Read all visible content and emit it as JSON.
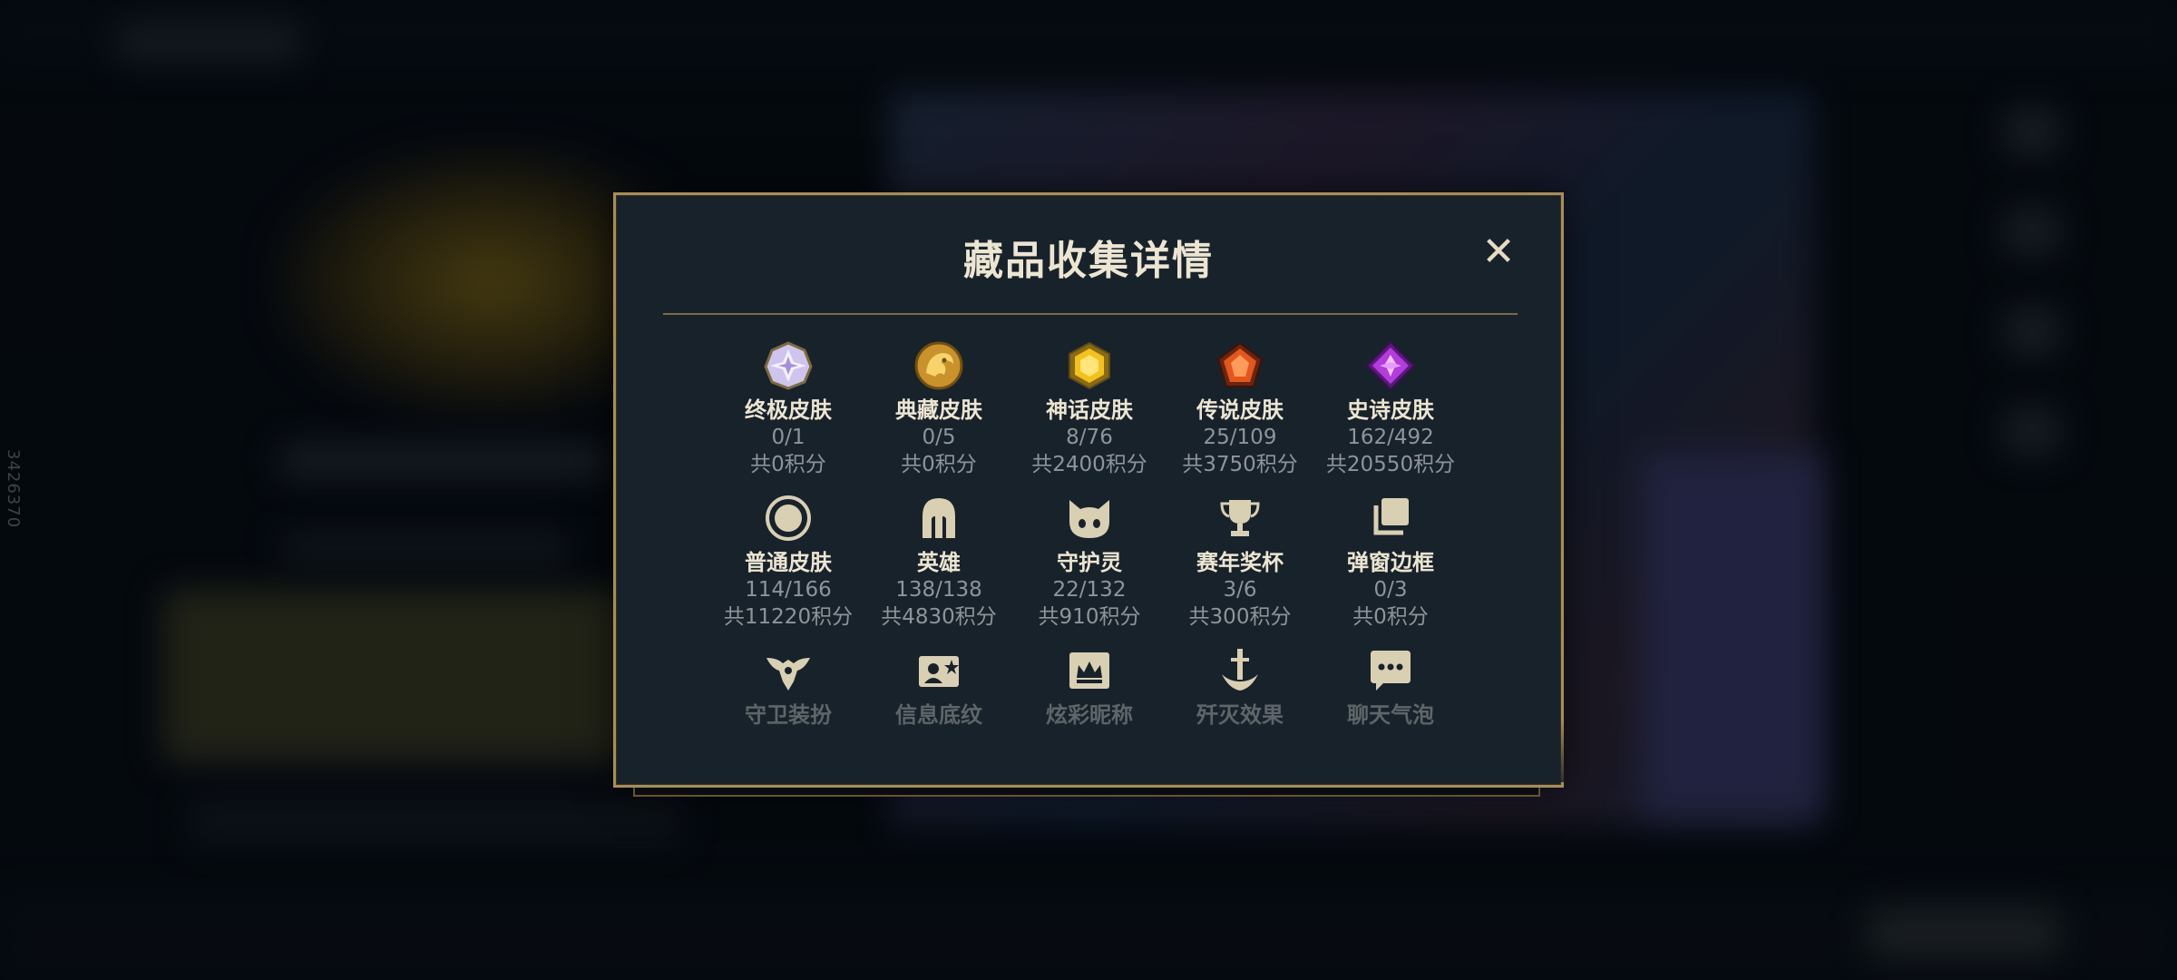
{
  "side_id": "3426370",
  "dialog": {
    "title": "藏品收集详情",
    "close_symbol": "✕"
  },
  "rows": [
    [
      {
        "label": "终极皮肤",
        "count": "0/1",
        "points": "共0积分",
        "icon": "ultimate-skin-icon"
      },
      {
        "label": "典藏皮肤",
        "count": "0/5",
        "points": "共0积分",
        "icon": "prestige-skin-icon"
      },
      {
        "label": "神话皮肤",
        "count": "8/76",
        "points": "共2400积分",
        "icon": "mythic-skin-icon"
      },
      {
        "label": "传说皮肤",
        "count": "25/109",
        "points": "共3750积分",
        "icon": "legendary-skin-icon"
      },
      {
        "label": "史诗皮肤",
        "count": "162/492",
        "points": "共20550积分",
        "icon": "epic-skin-icon"
      }
    ],
    [
      {
        "label": "普通皮肤",
        "count": "114/166",
        "points": "共11220积分",
        "icon": "normal-skin-icon"
      },
      {
        "label": "英雄",
        "count": "138/138",
        "points": "共4830积分",
        "icon": "champion-helmet-icon"
      },
      {
        "label": "守护灵",
        "count": "22/132",
        "points": "共910积分",
        "icon": "guardian-spirit-icon"
      },
      {
        "label": "赛年奖杯",
        "count": "3/6",
        "points": "共300积分",
        "icon": "trophy-icon"
      },
      {
        "label": "弹窗边框",
        "count": "0/3",
        "points": "共0积分",
        "icon": "popup-frame-icon"
      }
    ],
    [
      {
        "label": "守卫装扮",
        "icon": "ward-skin-icon"
      },
      {
        "label": "信息底纹",
        "icon": "profile-banner-icon"
      },
      {
        "label": "炫彩昵称",
        "icon": "colorful-nickname-icon"
      },
      {
        "label": "歼灭效果",
        "icon": "finisher-effect-icon"
      },
      {
        "label": "聊天气泡",
        "icon": "chat-bubble-icon"
      }
    ]
  ],
  "colors": {
    "gold_border": "#a88e55",
    "panel_bg": "#18222b",
    "title_text": "#ece5d2",
    "muted_text": "#8e949a"
  }
}
